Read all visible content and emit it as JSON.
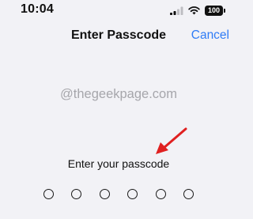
{
  "status_bar": {
    "time": "10:04",
    "battery_text": "100",
    "icons": [
      "signal-bars-icon",
      "wifi-icon",
      "battery-icon"
    ]
  },
  "nav": {
    "title": "Enter Passcode",
    "cancel_label": "Cancel"
  },
  "watermark": "@thegeekpage.com",
  "annotation": {
    "icon": "red-arrow-icon",
    "color": "#e02020"
  },
  "prompt": "Enter your passcode",
  "passcode": {
    "length": 6,
    "entered": 0
  },
  "colors": {
    "background": "#f2f2f6",
    "accent": "#2f7cf6",
    "text": "#111111"
  }
}
